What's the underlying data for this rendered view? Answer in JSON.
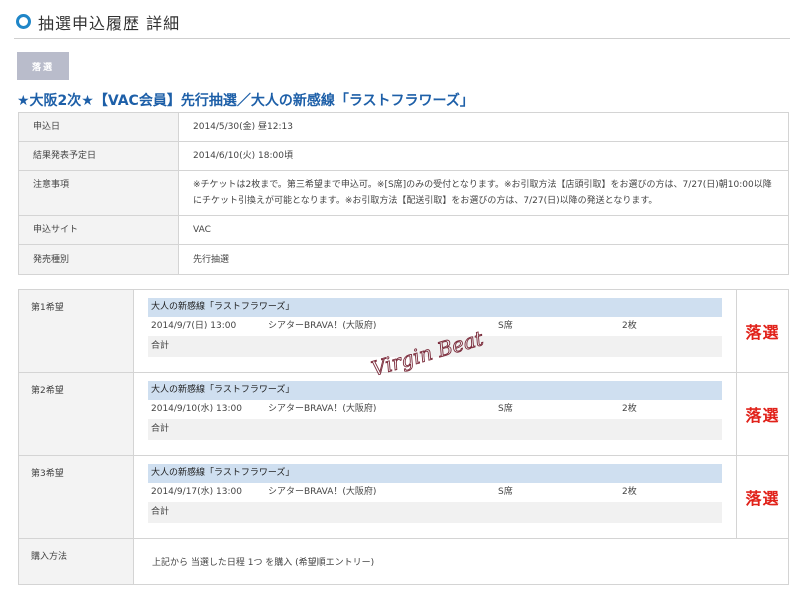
{
  "header": {
    "title": "抽選申込履歴 詳細"
  },
  "status_button": {
    "label": "落選"
  },
  "event": {
    "title": "★大阪2次★【VAC会員】先行抽選／大人の新感線「ラストフラワーズ」"
  },
  "info": [
    {
      "label": "申込日",
      "value": "2014/5/30(金) 昼12:13"
    },
    {
      "label": "結果発表予定日",
      "value": "2014/6/10(火) 18:00頃"
    },
    {
      "label": "注意事項",
      "value": "※チケットは2枚まで。第三希望まで申込可。※[S席]のみの受付となります。※お引取方法【店頭引取】をお選びの方は、7/27(日)朝10:00以降にチケット引換えが可能となります。※お引取方法【配送引取】をお選びの方は、7/27(日)以降の発送となります。"
    },
    {
      "label": "申込サイト",
      "value": "VAC"
    },
    {
      "label": "発売種別",
      "value": "先行抽選"
    }
  ],
  "preferences": [
    {
      "label": "第1希望",
      "show": "大人の新感線「ラストフラワーズ」",
      "date": "2014/9/7(日) 13:00",
      "venue": "シアターBRAVA！(大阪府)",
      "seat": "S席",
      "qty": "2枚",
      "total_label": "合計",
      "result": "落選"
    },
    {
      "label": "第2希望",
      "show": "大人の新感線「ラストフラワーズ」",
      "date": "2014/9/10(水) 13:00",
      "venue": "シアターBRAVA！(大阪府)",
      "seat": "S席",
      "qty": "2枚",
      "total_label": "合計",
      "result": "落選"
    },
    {
      "label": "第3希望",
      "show": "大人の新感線「ラストフラワーズ」",
      "date": "2014/9/17(水) 13:00",
      "venue": "シアターBRAVA！(大阪府)",
      "seat": "S席",
      "qty": "2枚",
      "total_label": "合計",
      "result": "落選"
    }
  ],
  "purchase": {
    "label": "購入方法",
    "value": "上記から 当選した日程 1つ を購入 (希望順エントリー)"
  },
  "watermark": {
    "text": "Virgin Beat"
  },
  "colors": {
    "accent": "#1f86c8",
    "title_blue": "#1d5fa8",
    "result_red": "#e1221a",
    "show_bg": "#cfdff0",
    "button_bg": "#b9bccb"
  }
}
